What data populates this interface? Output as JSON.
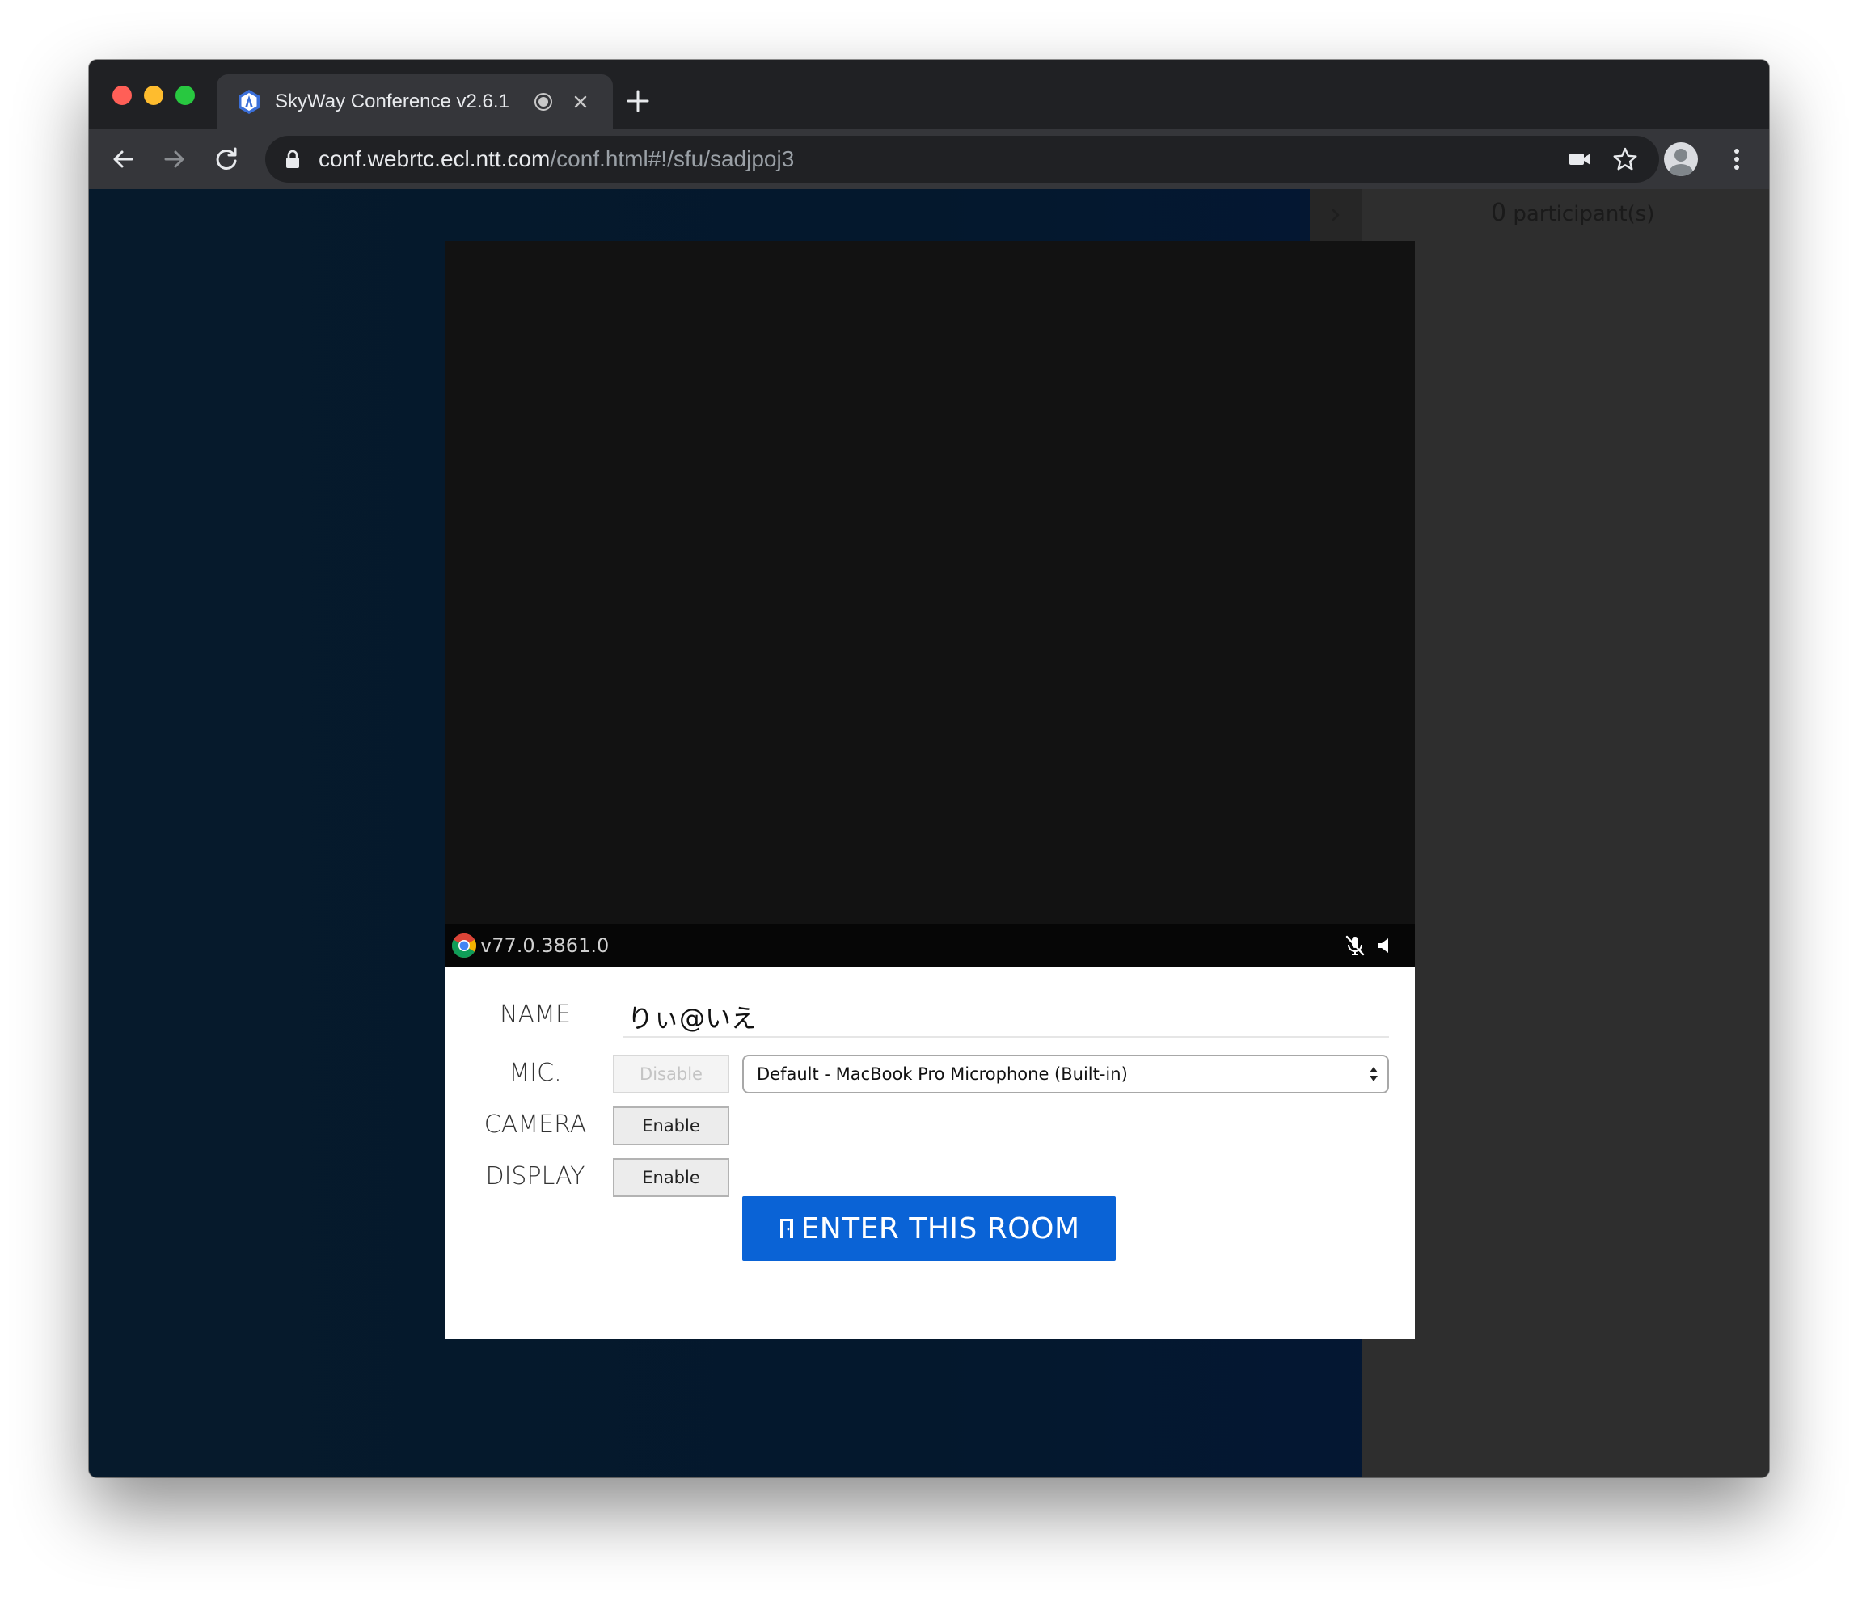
{
  "browser": {
    "tab": {
      "title": "SkyWay Conference v2.6.1",
      "favicon": "skyway-logo-icon",
      "recording": "recording-indicator-icon"
    },
    "address_bar": {
      "host": "conf.webrtc.ecl.ntt.com",
      "path": "/conf.html#!/sfu/sadjpoj3"
    },
    "icons": {
      "back": "arrow-left-icon",
      "forward": "arrow-right-icon",
      "reload": "reload-icon",
      "lock": "lock-icon",
      "camera_in_use": "video-camera-icon",
      "bookmark": "star-icon",
      "profile": "avatar",
      "menu": "kebab-menu-icon"
    }
  },
  "sidebar": {
    "participants_count": "0",
    "participants_label": " participant(s)",
    "toggle_icon": "chevron-right-icon"
  },
  "preview": {
    "browser_version": "v77.0.3861.0",
    "icons": [
      "chrome-logo-icon",
      "mic-muted-icon",
      "speaker-icon"
    ]
  },
  "form": {
    "name_label": "NAME",
    "name_value": "りぃ@いえ",
    "mic_label": "MIC.",
    "mic_button": "Disable",
    "mic_device": "Default - MacBook Pro Microphone (Built-in)",
    "camera_label": "CAMERA",
    "camera_button": "Enable",
    "display_label": "DISPLAY",
    "display_button": "Enable",
    "enter_button": "ENTER THIS ROOM"
  },
  "colors": {
    "enter_button": "#0a63d6",
    "page_background": "#061a2c",
    "side_panel": "#2e2e2e"
  }
}
